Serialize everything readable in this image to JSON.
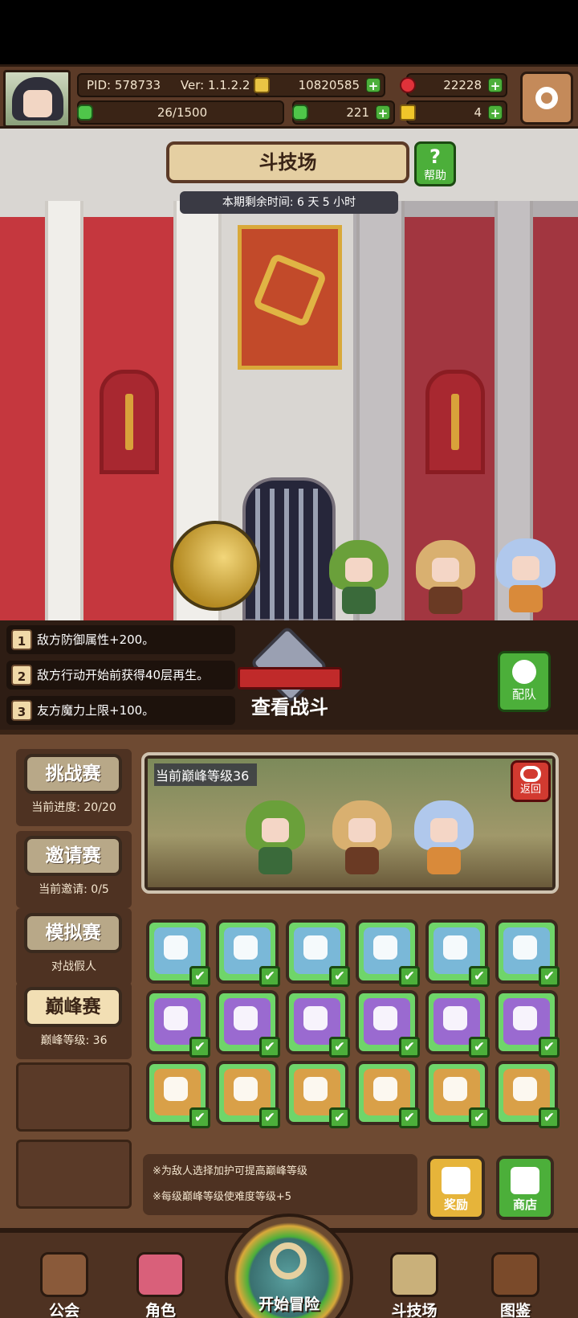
{
  "header": {
    "pid": "PID: 578733",
    "version": "Ver: 1.1.2.2",
    "gold": "10820585",
    "gems": "22228",
    "stamina": "26/1500",
    "clover": "221",
    "puzzle": "4"
  },
  "arena": {
    "title": "斗技场",
    "help_label": "帮助",
    "help_glyph": "?",
    "time_remaining": "本期剩余时间: 6 天 5 小时"
  },
  "buffs": [
    {
      "num": "1",
      "text": "敌方防御属性+200。"
    },
    {
      "num": "2",
      "text": "敌方行动开始前获得40层再生。"
    },
    {
      "num": "3",
      "text": "友方魔力上限+100。"
    }
  ],
  "actions": {
    "view_battle": "查看战斗",
    "team": "配队",
    "back": "返回",
    "reward": "奖励",
    "shop": "商店"
  },
  "modes": [
    {
      "label": "挑战赛",
      "sub": "当前进度: 20/20"
    },
    {
      "label": "邀请赛",
      "sub": "当前邀请: 0/5"
    },
    {
      "label": "模拟赛",
      "sub": "对战假人"
    },
    {
      "label": "巅峰赛",
      "sub": "巅峰等级: 36"
    }
  ],
  "peak": {
    "label": "当前巅峰等级36"
  },
  "modifier_grid": {
    "rows": [
      {
        "color": "blue",
        "icons": [
          "slime-icon",
          "shield-gear-icon",
          "sparkle-icon",
          "ring-icon",
          "blade-icon",
          "paw-icon"
        ]
      },
      {
        "color": "purple",
        "icons": [
          "sleep-icon",
          "skull-icon",
          "tombstone-icon",
          "mushroom-cloud-icon",
          "snowflake-icon",
          "wind-icon"
        ]
      },
      {
        "color": "orange",
        "icons": [
          "claw-icon",
          "crest-icon",
          "fire-icon",
          "armor-icon",
          "spiral-icon",
          "infinity-icon"
        ]
      }
    ],
    "check": "✔"
  },
  "notes": [
    "※为敌人选择加护可提高巅峰等级",
    "※每级巅峰等级使难度等级+5"
  ],
  "nav": {
    "guild": "公会",
    "role": "角色",
    "start": "开始冒险",
    "arena": "斗技场",
    "codex": "图鉴"
  },
  "colors": {
    "wood": "#6e4a32",
    "accent_green": "#4caf3a",
    "accent_red": "#c5373e",
    "gold": "#e9c444"
  }
}
